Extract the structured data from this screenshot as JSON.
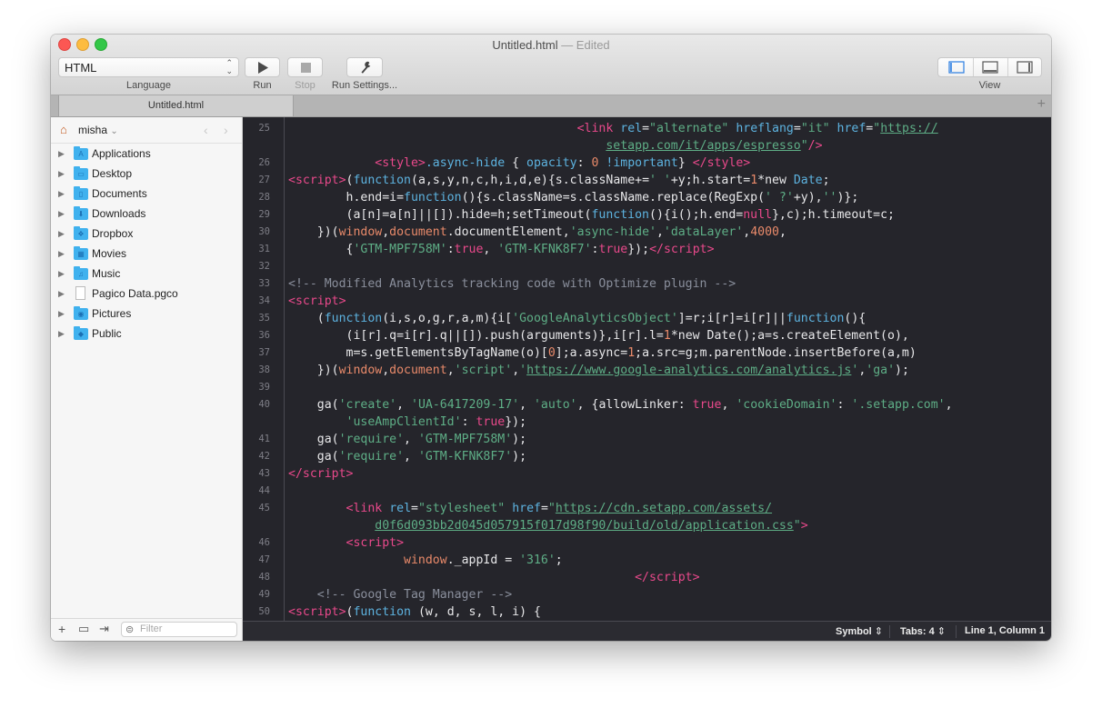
{
  "window": {
    "title": "Untitled.html",
    "title_suffix": " — Edited"
  },
  "toolbar": {
    "language_value": "HTML",
    "language_label": "Language",
    "run_label": "Run",
    "stop_label": "Stop",
    "run_settings_label": "Run Settings...",
    "view_label": "View"
  },
  "tabs": [
    {
      "label": "Untitled.html",
      "active": true
    }
  ],
  "tab_add_icon": "+",
  "sidebar": {
    "user": "misha",
    "items": [
      {
        "label": "Applications",
        "icon": "applications-folder-icon",
        "glyph": "A"
      },
      {
        "label": "Desktop",
        "icon": "desktop-folder-icon",
        "glyph": "▭"
      },
      {
        "label": "Documents",
        "icon": "documents-folder-icon",
        "glyph": "▯"
      },
      {
        "label": "Downloads",
        "icon": "downloads-folder-icon",
        "glyph": "⬇"
      },
      {
        "label": "Dropbox",
        "icon": "dropbox-folder-icon",
        "glyph": "❖"
      },
      {
        "label": "Movies",
        "icon": "movies-folder-icon",
        "glyph": "▦"
      },
      {
        "label": "Music",
        "icon": "music-folder-icon",
        "glyph": "♫"
      },
      {
        "label": "Pagico Data.pgco",
        "icon": "file-icon",
        "glyph": ""
      },
      {
        "label": "Pictures",
        "icon": "pictures-folder-icon",
        "glyph": "◉"
      },
      {
        "label": "Public",
        "icon": "public-folder-icon",
        "glyph": "◆"
      }
    ],
    "filter_placeholder": "Filter"
  },
  "editor": {
    "lines": [
      {
        "n": "25",
        "html": "                                        <span class='tag'>&lt;link</span> <span class='attr'>rel</span>=<span class='str'>\"alternate\"</span> <span class='attr'>hreflang</span>=<span class='str'>\"it\"</span> <span class='attr'>href</span>=<span class='str'>\"</span><span class='url'>https://</span>"
      },
      {
        "n": "",
        "html": "                                            <span class='url'>setapp.com/it/apps/espresso</span><span class='str'>\"</span><span class='tag'>/&gt;</span>"
      },
      {
        "n": "26",
        "html": "            <span class='tag'>&lt;style&gt;</span><span class='attr'>.async-hide</span> { <span class='attr'>opacity</span>: <span class='num'>0</span> <span class='attr'>!important</span>} <span class='tag'>&lt;/style&gt;</span>"
      },
      {
        "n": "27",
        "html": "<span class='tag'>&lt;script&gt;</span>(<span class='kw'>function</span>(a,s,y,n,c,h,i,d,e){s.className+=<span class='str'>' '</span>+y;h.start=<span class='num'>1</span>*new <span class='kw'>Date</span>;"
      },
      {
        "n": "28",
        "html": "        h.end=i=<span class='kw'>function</span>(){s.className=s.className.replace(RegExp(<span class='str'>' ?'</span>+y),<span class='str'>''</span>)};"
      },
      {
        "n": "29",
        "html": "        (a[n]=a[n]||[]).hide=h;setTimeout(<span class='kw'>function</span>(){i();h.end=<span class='bool'>null</span>},c);h.timeout=c;"
      },
      {
        "n": "30",
        "html": "    })(<span class='obj'>window</span>,<span class='obj'>document</span>.documentElement,<span class='str'>'async-hide'</span>,<span class='str'>'dataLayer'</span>,<span class='num'>4000</span>,"
      },
      {
        "n": "31",
        "html": "        {<span class='str'>'GTM-MPF758M'</span>:<span class='bool'>true</span>, <span class='str'>'GTM-KFNK8F7'</span>:<span class='bool'>true</span>});<span class='tag'>&lt;/script&gt;</span>"
      },
      {
        "n": "32",
        "html": ""
      },
      {
        "n": "33",
        "html": "<span class='com'>&lt;!-- Modified Analytics tracking code with Optimize plugin --&gt;</span>"
      },
      {
        "n": "34",
        "html": "<span class='tag'>&lt;script&gt;</span>"
      },
      {
        "n": "35",
        "html": "    (<span class='kw'>function</span>(i,s,o,g,r,a,m){i[<span class='str'>'GoogleAnalyticsObject'</span>]=r;i[r]=i[r]||<span class='kw'>function</span>(){"
      },
      {
        "n": "36",
        "html": "        (i[r].q=i[r].q||[]).push(arguments)},i[r].l=<span class='num'>1</span>*new Date();a=s.createElement(o),"
      },
      {
        "n": "37",
        "html": "        m=s.getElementsByTagName(o)[<span class='num'>0</span>];a.async=<span class='num'>1</span>;a.src=g;m.parentNode.insertBefore(a,m)"
      },
      {
        "n": "38",
        "html": "    })(<span class='obj'>window</span>,<span class='obj'>document</span>,<span class='str'>'script'</span>,<span class='str'>'</span><span class='url'>https://www.google-analytics.com/analytics.js</span><span class='str'>'</span>,<span class='str'>'ga'</span>);"
      },
      {
        "n": "39",
        "html": ""
      },
      {
        "n": "40",
        "html": "    ga(<span class='str'>'create'</span>, <span class='str'>'UA-6417209-17'</span>, <span class='str'>'auto'</span>, {allowLinker: <span class='bool'>true</span>, <span class='str'>'cookieDomain'</span>: <span class='str'>'.setapp.com'</span>,"
      },
      {
        "n": "",
        "html": "        <span class='str'>'useAmpClientId'</span>: <span class='bool'>true</span>});"
      },
      {
        "n": "41",
        "html": "    ga(<span class='str'>'require'</span>, <span class='str'>'GTM-MPF758M'</span>);"
      },
      {
        "n": "42",
        "html": "    ga(<span class='str'>'require'</span>, <span class='str'>'GTM-KFNK8F7'</span>);"
      },
      {
        "n": "43",
        "html": "<span class='tag'>&lt;/script&gt;</span>"
      },
      {
        "n": "44",
        "html": ""
      },
      {
        "n": "45",
        "html": "        <span class='tag'>&lt;link</span> <span class='attr'>rel</span>=<span class='str'>\"stylesheet\"</span> <span class='attr'>href</span>=<span class='str'>\"</span><span class='url'>https://cdn.setapp.com/assets/</span>"
      },
      {
        "n": "",
        "html": "            <span class='url'>d0f6d093bb2d045d057915f017d98f90/build/old/application.css</span><span class='str'>\"</span><span class='tag'>&gt;</span>"
      },
      {
        "n": "46",
        "html": "        <span class='tag'>&lt;script&gt;</span>"
      },
      {
        "n": "47",
        "html": "                <span class='obj'>window</span>._appId = <span class='str'>'316'</span>;"
      },
      {
        "n": "48",
        "html": "                                                <span class='tag'>&lt;/script&gt;</span>"
      },
      {
        "n": "49",
        "html": "    <span class='com'>&lt;!-- Google Tag Manager --&gt;</span>"
      },
      {
        "n": "50",
        "html": "<span class='tag'>&lt;script&gt;</span>(<span class='kw'>function</span> (w, d, s, l, i) {"
      }
    ]
  },
  "statusbar": {
    "symbol_label": "Symbol",
    "tabs_label": "Tabs: 4",
    "position_label": "Line 1, Column 1"
  }
}
